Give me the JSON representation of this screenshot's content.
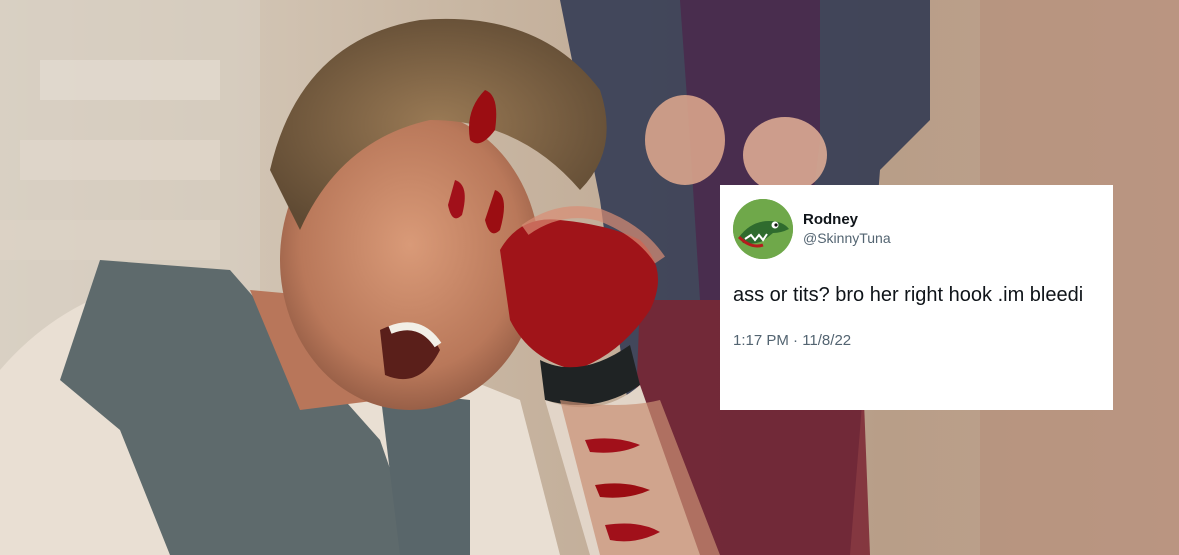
{
  "tweet": {
    "display_name": "Rodney",
    "handle": "@SkinnyTuna",
    "text": "ass or tits? bro her right hook .im bleedi",
    "timestamp": "1:17 PM · 11/8/22"
  },
  "background_photo": {
    "subject": "photo-background"
  },
  "colors": {
    "card_background": "#ffffff",
    "text_primary": "#0f1419",
    "text_secondary": "#536471",
    "avatar_green": "#6fa84a"
  }
}
